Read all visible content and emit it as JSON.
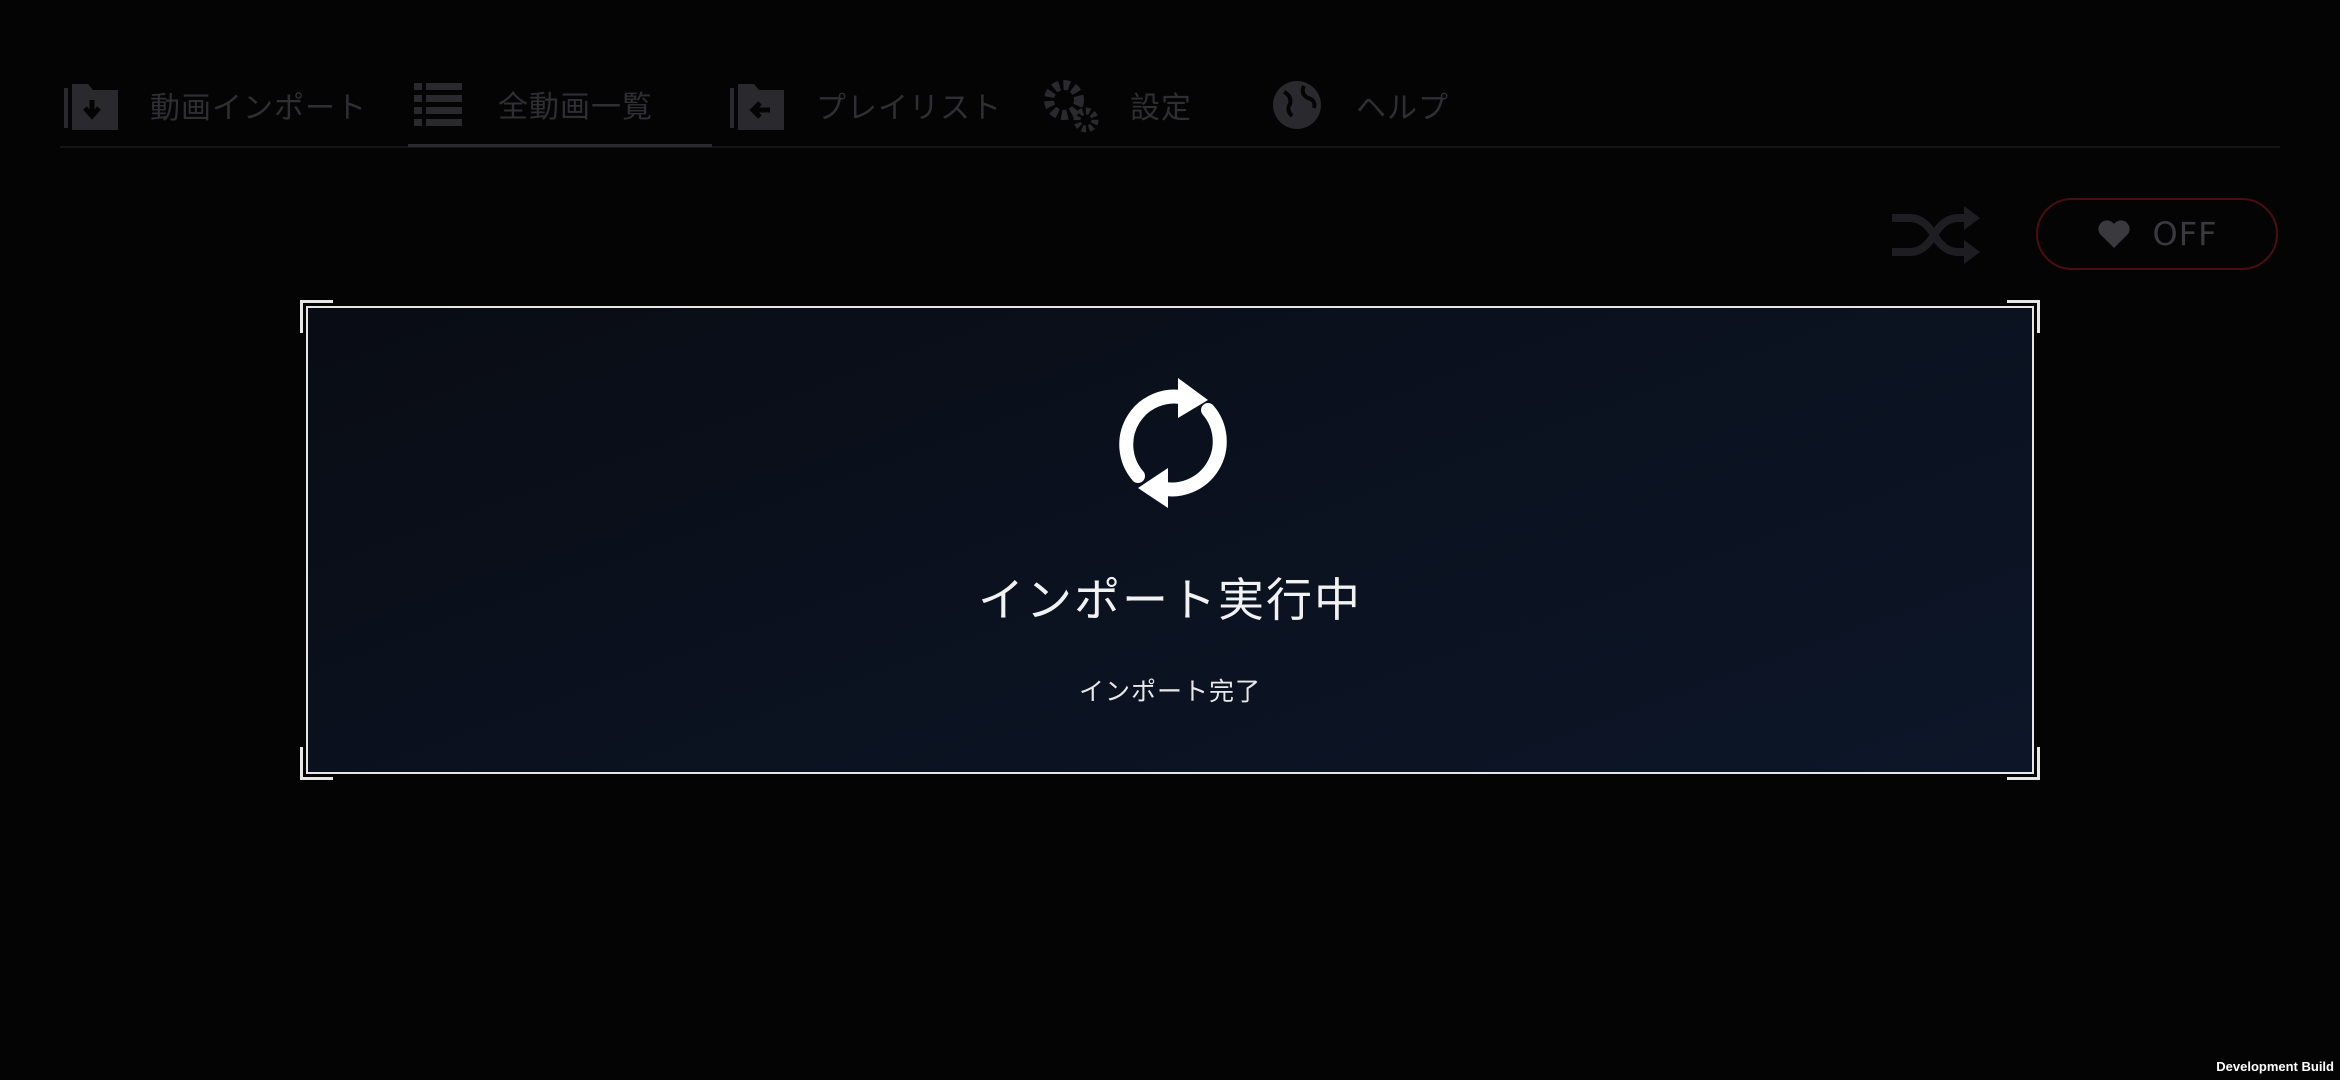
{
  "nav": {
    "items": [
      {
        "label": "動画インポート",
        "icon": "folder-import-icon"
      },
      {
        "label": "全動画一覧",
        "icon": "list-icon",
        "active": true
      },
      {
        "label": "プレイリスト",
        "icon": "folder-playlist-icon"
      },
      {
        "label": "設定",
        "icon": "gear-icon"
      },
      {
        "label": "ヘルプ",
        "icon": "globe-icon"
      }
    ]
  },
  "controls": {
    "shuffle_icon": "shuffle-icon",
    "favorite_icon": "heart-icon",
    "favorite_state": "OFF",
    "favorite_border_color": "#4a0d10"
  },
  "dialog": {
    "icon": "sync-icon",
    "title": "インポート実行中",
    "status": "インポート完了"
  },
  "footer": {
    "build_label": "Development Build"
  },
  "colors": {
    "background": "#040405",
    "dialog_border": "#e6e6e6",
    "dialog_background": "#0b1220",
    "nav_text": "#2f2f33"
  }
}
